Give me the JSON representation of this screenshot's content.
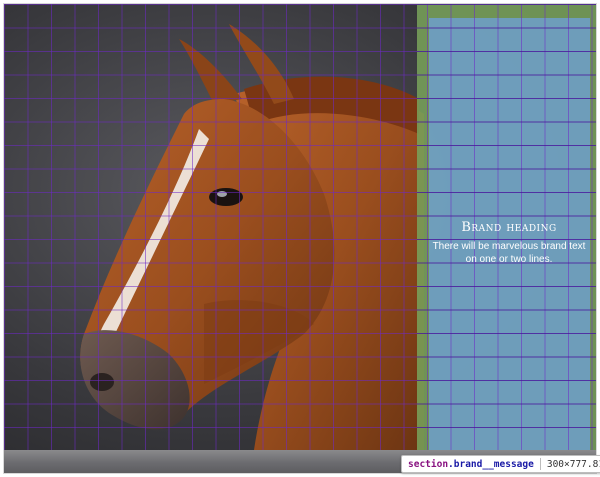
{
  "brand": {
    "heading": "Brand heading",
    "body": "There will be marvelous brand text on one or two lines."
  },
  "devtools_tooltip": {
    "tag": "section",
    "class_name": ".brand__message",
    "dimensions": "300×777.81"
  },
  "colors": {
    "grid_line": "#6e28c8",
    "margin_highlight": "#78a05a",
    "content_highlight": "#6ea0d7",
    "horse_coat": "#9a4e1e"
  }
}
